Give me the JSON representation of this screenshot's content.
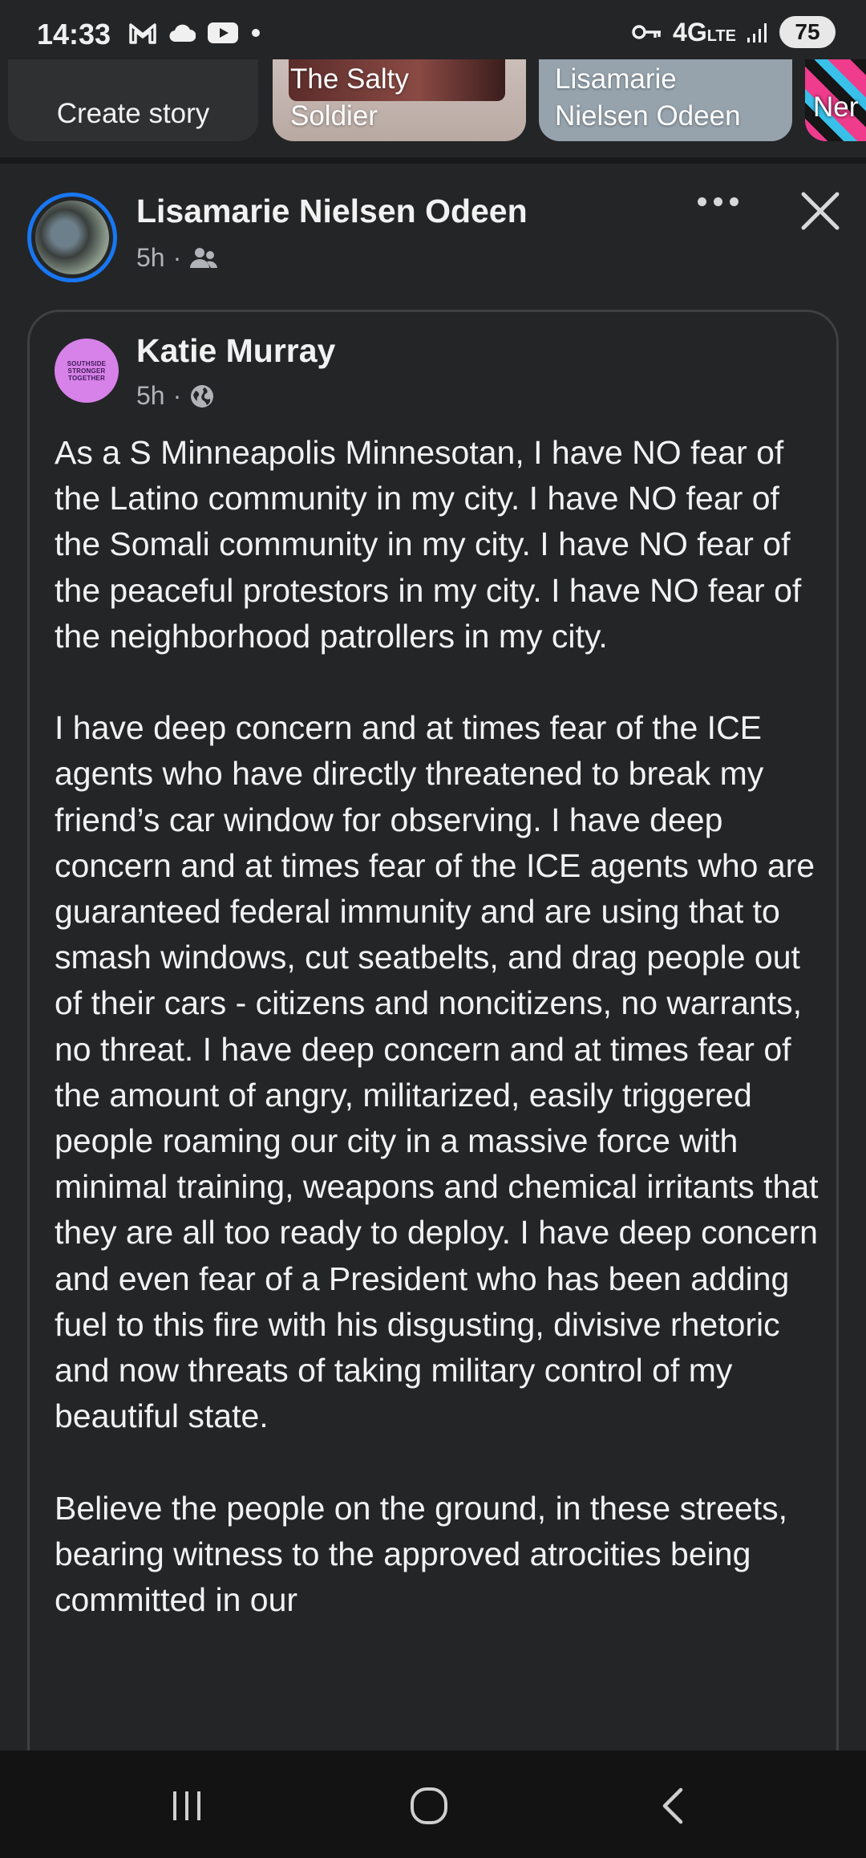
{
  "status_bar": {
    "time": "14:33",
    "network": "4G",
    "network_sub": "LTE",
    "battery": "75"
  },
  "stories": [
    {
      "label": "Create story"
    },
    {
      "label": "The Salty Soldier"
    },
    {
      "label": "Lisamarie Nielsen Odeen"
    },
    {
      "label": "Ner"
    }
  ],
  "post": {
    "author": "Lisamarie Nielsen Odeen",
    "time": "5h",
    "separator": "·",
    "audience_icon": "friends-icon"
  },
  "shared_post": {
    "author": "Katie Murray",
    "time": "5h",
    "separator": "·",
    "audience_icon": "globe-icon",
    "avatar_text": "SOUTHSIDE STRONGER TOGETHER",
    "body": "As a S Minneapolis Minnesotan, I have NO fear of the Latino community in my city. I have NO fear of the Somali community in my city. I have NO fear of the peaceful protestors in my city. I have NO fear of the neighborhood patrollers in my city.\n\nI have deep concern and at times fear of the ICE agents who have directly threatened to break my friend’s car window for observing. I have deep concern and at times fear of the ICE agents who are guaranteed federal immunity and are using that to smash windows, cut seatbelts, and drag people out of their cars - citizens and noncitizens, no warrants, no threat. I have deep concern and at times fear of the amount of angry, militarized, easily triggered people roaming our city in a massive force with minimal training, weapons and chemical irritants that they are all too ready to deploy. I have deep concern and even fear of a President who has been adding fuel to this fire with his disgusting, divisive rhetoric and now threats of taking military control of my beautiful state.\n\nBelieve the people on the ground, in these streets, bearing witness to the approved atrocities being committed in our"
  },
  "nav_bar": {
    "recent_icon": "recent-apps-icon",
    "home_icon": "home-icon",
    "back_icon": "back-icon"
  },
  "colors": {
    "background": "#242527",
    "accent_ring": "#1877f2",
    "text": "#f2f2f2",
    "secondary_text": "#b0b3b8"
  }
}
